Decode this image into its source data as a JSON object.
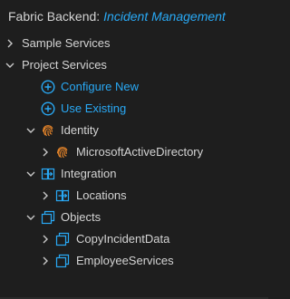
{
  "header": {
    "prefix": "Fabric Backend:",
    "project": "Incident Management"
  },
  "tree": {
    "sample_services": "Sample Services",
    "project_services": "Project Services",
    "configure_new": "Configure New",
    "use_existing": "Use Existing",
    "identity": "Identity",
    "microsoft_ad": "MicrosoftActiveDirectory",
    "integration": "Integration",
    "locations": "Locations",
    "objects": "Objects",
    "copy_incident_data": "CopyIncidentData",
    "employee_services": "EmployeeServices"
  },
  "colors": {
    "accent": "#29a9f5",
    "identity_orange": "#e8862a",
    "background": "#1e1e1e"
  }
}
